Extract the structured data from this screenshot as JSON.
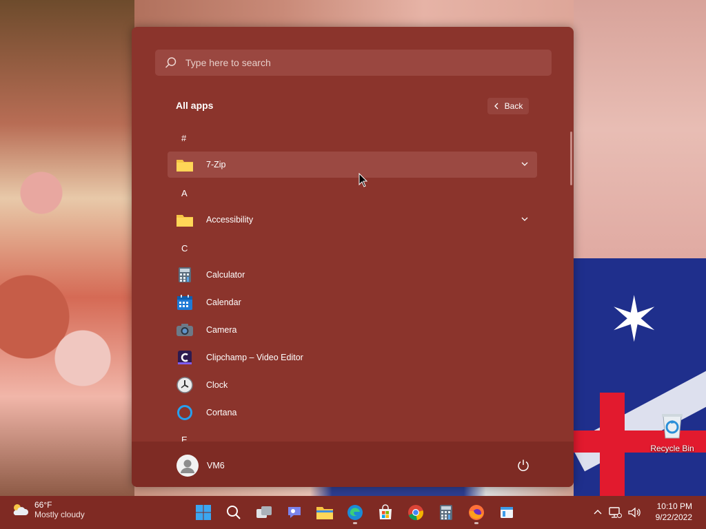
{
  "start_menu": {
    "search_placeholder": "Type here to search",
    "all_apps_title": "All apps",
    "back_label": "Back",
    "groups": [
      {
        "letter": "#",
        "apps": [
          {
            "name": "7-Zip",
            "icon": "folder-icon",
            "expandable": true
          }
        ]
      },
      {
        "letter": "A",
        "apps": [
          {
            "name": "Accessibility",
            "icon": "folder-icon",
            "expandable": true
          }
        ]
      },
      {
        "letter": "C",
        "apps": [
          {
            "name": "Calculator",
            "icon": "calculator-icon"
          },
          {
            "name": "Calendar",
            "icon": "calendar-icon"
          },
          {
            "name": "Camera",
            "icon": "camera-icon"
          },
          {
            "name": "Clipchamp – Video Editor",
            "icon": "clipchamp-icon"
          },
          {
            "name": "Clock",
            "icon": "clock-icon"
          },
          {
            "name": "Cortana",
            "icon": "cortana-icon"
          }
        ]
      },
      {
        "letter": "E",
        "apps": []
      }
    ],
    "user_name": "VM6",
    "accent_color": "#8b342c"
  },
  "desktop": {
    "recycle_bin_label": "Recycle Bin"
  },
  "taskbar": {
    "weather_temp": "66°F",
    "weather_condition": "Mostly cloudy",
    "pinned": [
      "start-icon",
      "search-icon",
      "task-view-icon",
      "teams-chat-icon",
      "file-explorer-icon",
      "edge-icon",
      "store-icon",
      "chrome-icon",
      "calculator-icon",
      "firefox-icon",
      "notepad-icon"
    ],
    "time": "10:10 PM",
    "date": "9/22/2022"
  }
}
